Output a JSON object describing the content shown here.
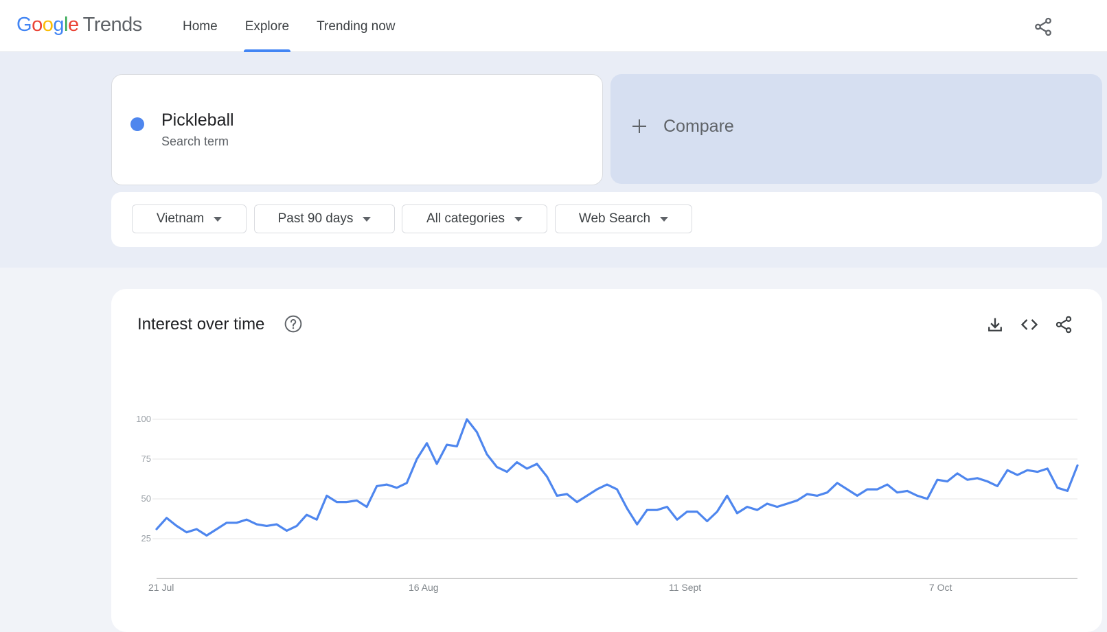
{
  "header": {
    "logo_google": "Google",
    "logo_trends": "Trends",
    "nav": [
      {
        "label": "Home",
        "active": false
      },
      {
        "label": "Explore",
        "active": true
      },
      {
        "label": "Trending now",
        "active": false
      }
    ]
  },
  "term": {
    "name": "Pickleball",
    "type": "Search term",
    "color": "#4e86ee"
  },
  "compare": {
    "label": "Compare"
  },
  "filters": [
    {
      "label": "Vietnam"
    },
    {
      "label": "Past 90 days"
    },
    {
      "label": "All categories"
    },
    {
      "label": "Web Search"
    }
  ],
  "chart_card": {
    "title": "Interest over time"
  },
  "chart_data": {
    "type": "line",
    "title": "Interest over time",
    "xlabel": "",
    "ylabel": "",
    "ylim": [
      0,
      100
    ],
    "yticks": [
      25,
      50,
      75,
      100
    ],
    "x_tick_labels": [
      "21 Jul",
      "16 Aug",
      "11 Sept",
      "7 Oct"
    ],
    "x_tick_index": [
      0,
      26,
      52,
      78
    ],
    "grid": true,
    "series": [
      {
        "color": "#4e86ee",
        "values": [
          31,
          38,
          33,
          29,
          31,
          27,
          31,
          35,
          35,
          37,
          34,
          33,
          34,
          30,
          33,
          40,
          37,
          52,
          48,
          48,
          49,
          45,
          58,
          59,
          57,
          60,
          75,
          85,
          72,
          84,
          83,
          100,
          92,
          78,
          70,
          67,
          73,
          69,
          72,
          64,
          52,
          53,
          48,
          52,
          56,
          59,
          56,
          44,
          34,
          43,
          43,
          45,
          37,
          42,
          42,
          36,
          42,
          52,
          41,
          45,
          43,
          47,
          45,
          47,
          49,
          53,
          52,
          54,
          60,
          56,
          52,
          56,
          56,
          59,
          54,
          55,
          52,
          50,
          62,
          61,
          66,
          62,
          63,
          61,
          58,
          68,
          65,
          68,
          67,
          69,
          57,
          55,
          71
        ]
      }
    ]
  }
}
